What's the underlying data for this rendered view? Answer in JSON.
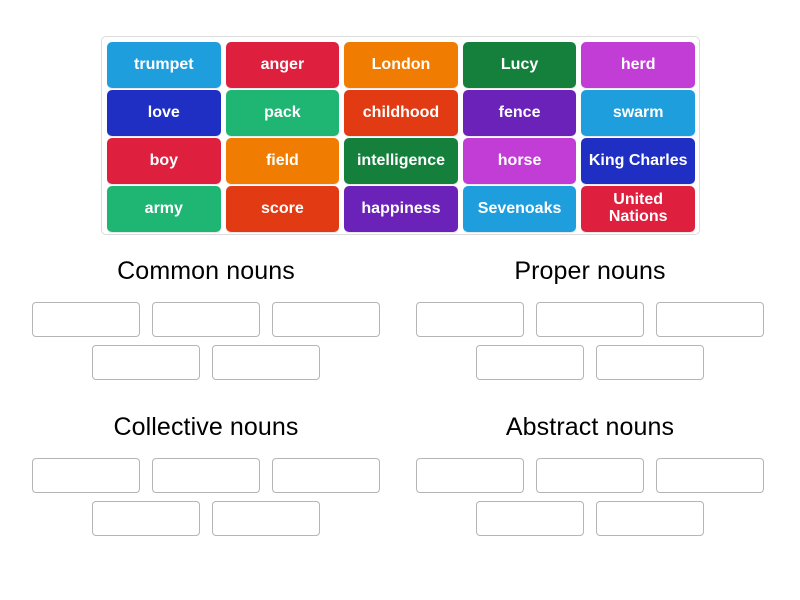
{
  "activity": {
    "type": "group-sort",
    "colors": {
      "sky_blue": "#1f9ede",
      "crimson": "#de1f3d",
      "orange": "#f07d02",
      "forest_green": "#14803c",
      "orchid": "#c23cd6",
      "royal_blue": "#1f2fc4",
      "emerald": "#1fb573",
      "orange_red": "#e23b14",
      "purple": "#6a22b8",
      "panel_border": "#dcdcdc",
      "slot_border": "#b5b5b5",
      "background": "#ffffff",
      "heading_text": "#000000",
      "tile_text": "#ffffff"
    }
  },
  "word_bank": {
    "rows": [
      [
        {
          "label": "trumpet",
          "color": "#1f9ede"
        },
        {
          "label": "anger",
          "color": "#de1f3d"
        },
        {
          "label": "London",
          "color": "#f07d02"
        },
        {
          "label": "Lucy",
          "color": "#14803c"
        },
        {
          "label": "herd",
          "color": "#c23cd6"
        }
      ],
      [
        {
          "label": "love",
          "color": "#1f2fc4"
        },
        {
          "label": "pack",
          "color": "#1fb573"
        },
        {
          "label": "childhood",
          "color": "#e23b14"
        },
        {
          "label": "fence",
          "color": "#6a22b8"
        },
        {
          "label": "swarm",
          "color": "#1f9ede"
        }
      ],
      [
        {
          "label": "boy",
          "color": "#de1f3d"
        },
        {
          "label": "field",
          "color": "#f07d02"
        },
        {
          "label": "intelligence",
          "color": "#14803c"
        },
        {
          "label": "horse",
          "color": "#c23cd6"
        },
        {
          "label": "King Charles",
          "color": "#1f2fc4"
        }
      ],
      [
        {
          "label": "army",
          "color": "#1fb573"
        },
        {
          "label": "score",
          "color": "#e23b14"
        },
        {
          "label": "happiness",
          "color": "#6a22b8"
        },
        {
          "label": "Sevenoaks",
          "color": "#1f9ede"
        },
        {
          "label": "United Nations",
          "color": "#de1f3d"
        }
      ]
    ]
  },
  "groups": [
    {
      "title": "Common nouns",
      "slots_row1": 3,
      "slots_row2": 2,
      "slot_values": [
        "",
        "",
        "",
        "",
        ""
      ]
    },
    {
      "title": "Proper nouns",
      "slots_row1": 3,
      "slots_row2": 2,
      "slot_values": [
        "",
        "",
        "",
        "",
        ""
      ]
    },
    {
      "title": "Collective nouns",
      "slots_row1": 3,
      "slots_row2": 2,
      "slot_values": [
        "",
        "",
        "",
        "",
        ""
      ]
    },
    {
      "title": "Abstract nouns",
      "slots_row1": 3,
      "slots_row2": 2,
      "slot_values": [
        "",
        "",
        "",
        "",
        ""
      ]
    }
  ]
}
